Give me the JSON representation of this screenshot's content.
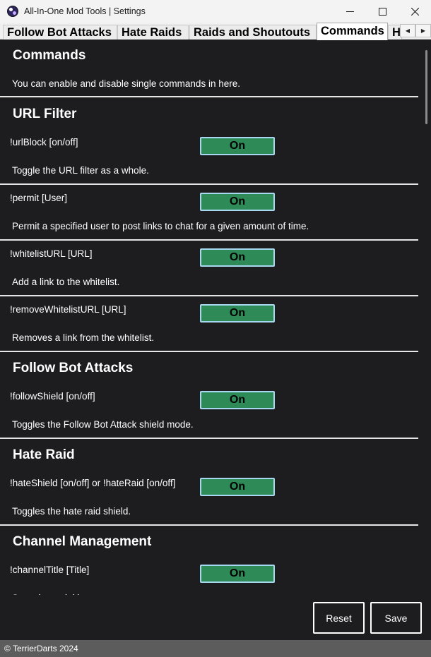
{
  "window": {
    "title": "All-In-One Mod Tools | Settings",
    "minimize_icon": "minimize-icon",
    "maximize_icon": "maximize-icon",
    "close_icon": "close-icon"
  },
  "tabs": [
    {
      "label": "Follow Bot Attacks",
      "active": false
    },
    {
      "label": "Hate Raids",
      "active": false
    },
    {
      "label": "Raids and Shoutouts",
      "active": false
    },
    {
      "label": "Commands",
      "active": true
    },
    {
      "label": "H",
      "active": false
    }
  ],
  "commands_intro": {
    "title": "Commands",
    "description": "You can enable and disable single commands in here."
  },
  "url_filter": {
    "title": "URL Filter",
    "items": [
      {
        "command": "!urlBlock [on/off]",
        "state": "On",
        "description": "Toggle the URL filter as a whole."
      },
      {
        "command": "!permit [User]",
        "state": "On",
        "description": "Permit a specified user to post links to chat for a given amount of time."
      },
      {
        "command": "!whitelistURL [URL]",
        "state": "On",
        "description": "Add a link to the whitelist."
      },
      {
        "command": "!removeWhitelistURL [URL]",
        "state": "On",
        "description": "Removes a link from the whitelist."
      }
    ]
  },
  "follow_bot_attacks": {
    "title": "Follow Bot Attacks",
    "items": [
      {
        "command": "!followShield [on/off]",
        "state": "On",
        "description": "Toggles the Follow Bot Attack shield mode."
      }
    ]
  },
  "hate_raid": {
    "title": "Hate Raid",
    "items": [
      {
        "command": "!hateShield [on/off] or !hateRaid [on/off]",
        "state": "On",
        "description": "Toggles the hate raid shield."
      }
    ]
  },
  "channel_management": {
    "title": "Channel Management",
    "items": [
      {
        "command": "!channelTitle [Title]",
        "state": "On",
        "description": "Sets channel title"
      }
    ]
  },
  "buttons": {
    "reset": "Reset",
    "save": "Save"
  },
  "footer": {
    "copyright": "© TerrierDarts 2024"
  },
  "colors": {
    "toggle_on": "#2e8a57",
    "toggle_border": "#a8d8f0",
    "panel_bg": "#1d1d1f",
    "footer_bg": "#5c5c5c"
  }
}
